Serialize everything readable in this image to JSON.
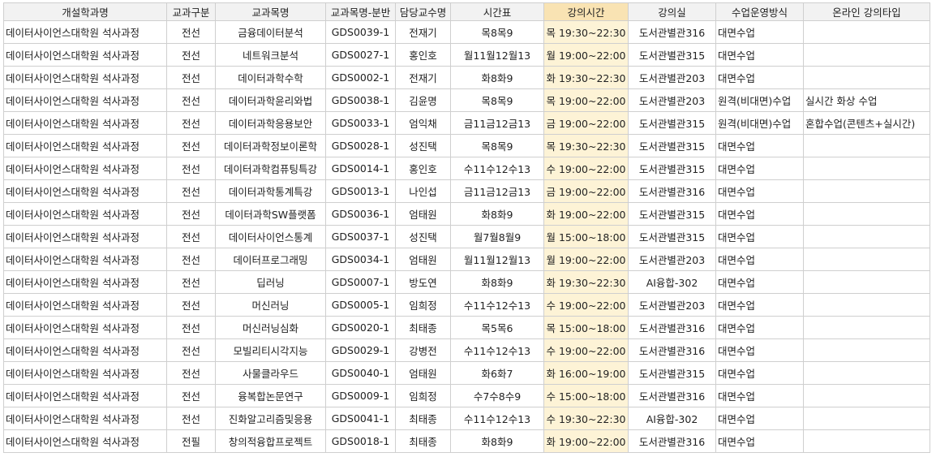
{
  "columns": [
    "개설학과명",
    "교과구분",
    "교과목명",
    "교과목명-분반",
    "담당교수명",
    "시간표",
    "강의시간",
    "강의실",
    "수업운영방식",
    "온라인 강의타입"
  ],
  "rows": [
    [
      "데이터사이언스대학원 석사과정",
      "전선",
      "금융데이터분석",
      "GDS0039-1",
      "전재기",
      "목8목9",
      "목 19:30~22:30",
      "도서관별관316",
      "대면수업",
      ""
    ],
    [
      "데이터사이언스대학원 석사과정",
      "전선",
      "네트워크분석",
      "GDS0027-1",
      "홍인호",
      "월11월12월13",
      "월 19:00~22:00",
      "도서관별관315",
      "대면수업",
      ""
    ],
    [
      "데이터사이언스대학원 석사과정",
      "전선",
      "데이터과학수학",
      "GDS0002-1",
      "전재기",
      "화8화9",
      "화 19:30~22:30",
      "도서관별관203",
      "대면수업",
      ""
    ],
    [
      "데이터사이언스대학원 석사과정",
      "전선",
      "데이터과학윤리와법",
      "GDS0038-1",
      "김윤명",
      "목8목9",
      "목 19:00~22:00",
      "도서관별관203",
      "원격(비대면)수업",
      "실시간 화상 수업"
    ],
    [
      "데이터사이언스대학원 석사과정",
      "전선",
      "데이터과학응용보안",
      "GDS0033-1",
      "엄익채",
      "금11금12금13",
      "금 19:00~22:00",
      "도서관별관315",
      "원격(비대면)수업",
      "혼합수업(콘텐츠+실시간)"
    ],
    [
      "데이터사이언스대학원 석사과정",
      "전선",
      "데이터과학정보이론학",
      "GDS0028-1",
      "성진택",
      "목8목9",
      "목 19:30~22:30",
      "도서관별관315",
      "대면수업",
      ""
    ],
    [
      "데이터사이언스대학원 석사과정",
      "전선",
      "데이터과학컴퓨팅특강",
      "GDS0014-1",
      "홍인호",
      "수11수12수13",
      "수 19:00~22:00",
      "도서관별관315",
      "대면수업",
      ""
    ],
    [
      "데이터사이언스대학원 석사과정",
      "전선",
      "데이터과학통계특강",
      "GDS0013-1",
      "나인섭",
      "금11금12금13",
      "금 19:00~22:00",
      "도서관별관316",
      "대면수업",
      ""
    ],
    [
      "데이터사이언스대학원 석사과정",
      "전선",
      "데이터과학SW플랫폼",
      "GDS0036-1",
      "엄태원",
      "화8화9",
      "화 19:00~22:00",
      "도서관별관315",
      "대면수업",
      ""
    ],
    [
      "데이터사이언스대학원 석사과정",
      "전선",
      "데이터사이언스통계",
      "GDS0037-1",
      "성진택",
      "월7월8월9",
      "월 15:00~18:00",
      "도서관별관315",
      "대면수업",
      ""
    ],
    [
      "데이터사이언스대학원 석사과정",
      "전선",
      "데이터프로그래밍",
      "GDS0034-1",
      "엄태원",
      "월11월12월13",
      "월 19:00~22:00",
      "도서관별관203",
      "대면수업",
      ""
    ],
    [
      "데이터사이언스대학원 석사과정",
      "전선",
      "딥러닝",
      "GDS0007-1",
      "방도연",
      "화8화9",
      "화 19:30~22:30",
      "AI융합-302",
      "대면수업",
      ""
    ],
    [
      "데이터사이언스대학원 석사과정",
      "전선",
      "머신러닝",
      "GDS0005-1",
      "임희정",
      "수11수12수13",
      "수 19:00~22:00",
      "도서관별관203",
      "대면수업",
      ""
    ],
    [
      "데이터사이언스대학원 석사과정",
      "전선",
      "머신러닝심화",
      "GDS0020-1",
      "최태종",
      "목5목6",
      "목 15:00~18:00",
      "도서관별관316",
      "대면수업",
      ""
    ],
    [
      "데이터사이언스대학원 석사과정",
      "전선",
      "모빌리티시각지능",
      "GDS0029-1",
      "강병전",
      "수11수12수13",
      "수 19:00~22:00",
      "도서관별관316",
      "대면수업",
      ""
    ],
    [
      "데이터사이언스대학원 석사과정",
      "전선",
      "사물클라우드",
      "GDS0040-1",
      "엄태원",
      "화6화7",
      "화 16:00~19:00",
      "도서관별관315",
      "대면수업",
      ""
    ],
    [
      "데이터사이언스대학원 석사과정",
      "전선",
      "융복합논문연구",
      "GDS0009-1",
      "임희정",
      "수7수8수9",
      "수 15:00~18:00",
      "도서관별관316",
      "대면수업",
      ""
    ],
    [
      "데이터사이언스대학원 석사과정",
      "전선",
      "진화알고리즘및응용",
      "GDS0041-1",
      "최태종",
      "수11수12수13",
      "수 19:30~22:30",
      "AI융합-302",
      "대면수업",
      ""
    ],
    [
      "데이터사이언스대학원 석사과정",
      "전필",
      "창의적융합프로젝트",
      "GDS0018-1",
      "최태종",
      "화8화9",
      "화 19:00~22:00",
      "도서관별관316",
      "대면수업",
      ""
    ]
  ]
}
